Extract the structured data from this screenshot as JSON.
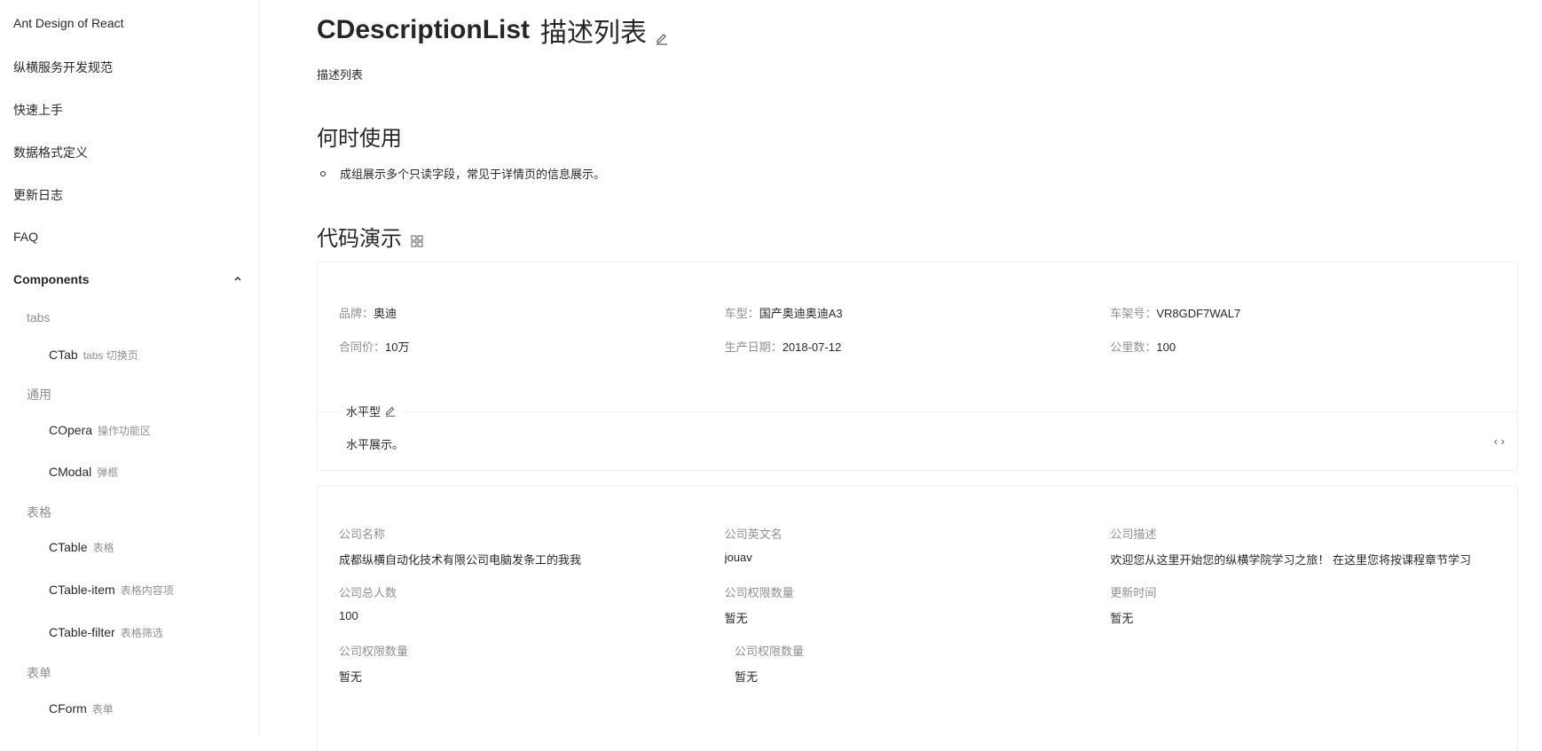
{
  "sidebar": {
    "items": [
      {
        "label": "Ant Design of React"
      },
      {
        "label": "纵横服务开发规范"
      },
      {
        "label": "快速上手"
      },
      {
        "label": "数据格式定义"
      },
      {
        "label": "更新日志"
      },
      {
        "label": "FAQ"
      }
    ],
    "group": {
      "label": "Components",
      "icon": "chevron-up-icon"
    },
    "categories": [
      {
        "label": "tabs",
        "subs": [
          {
            "label": "CTab",
            "desc": "tabs 切换页"
          }
        ]
      },
      {
        "label": "通用",
        "subs": [
          {
            "label": "COpera",
            "desc": "操作功能区"
          },
          {
            "label": "CModal",
            "desc": "弹框"
          }
        ]
      },
      {
        "label": "表格",
        "subs": [
          {
            "label": "CTable",
            "desc": "表格"
          },
          {
            "label": "CTable-item",
            "desc": "表格内容项"
          },
          {
            "label": "CTable-filter",
            "desc": "表格筛选"
          }
        ]
      },
      {
        "label": "表单",
        "subs": [
          {
            "label": "CForm",
            "desc": "表单"
          }
        ]
      }
    ]
  },
  "main": {
    "title_name": "CDescriptionList",
    "title_cn": "描述列表",
    "subtitle": "描述列表",
    "when_heading": "何时使用",
    "when_bullet": "成组展示多个只读字段，常见于详情页的信息展示。",
    "demo_heading": "代码演示",
    "demo1": {
      "rows": [
        [
          {
            "label": "品牌：",
            "value": "奥迪"
          },
          {
            "label": "车型：",
            "value": "国产奥迪奥迪A3"
          },
          {
            "label": "车架号：",
            "value": "VR8GDF7WAL7"
          }
        ],
        [
          {
            "label": "合同价：",
            "value": "10万"
          },
          {
            "label": "生产日期：",
            "value": "2018-07-12"
          },
          {
            "label": "公里数：",
            "value": "100"
          }
        ]
      ],
      "meta_title": "水平型",
      "meta_desc": "水平展示。",
      "code_toggle": "‹ ›"
    },
    "demo2": {
      "rows": [
        [
          {
            "label": "公司名称",
            "value": "成都纵横自动化技术有限公司电脑发条工的我我"
          },
          {
            "label": "公司英文名",
            "value": "jouav"
          },
          {
            "label": "公司描述",
            "value": "欢迎您从这里开始您的纵横学院学习之旅！ 在这里您将按课程章节学习"
          }
        ],
        [
          {
            "label": "公司总人数",
            "value": "100"
          },
          {
            "label": "公司权限数量",
            "value": "暂无"
          },
          {
            "label": "更新时间",
            "value": "暂无"
          }
        ],
        [
          {
            "label": "公司权限数量",
            "value": "暂无"
          },
          {
            "label": "公司权限数量",
            "value": "暂无"
          }
        ]
      ]
    }
  }
}
